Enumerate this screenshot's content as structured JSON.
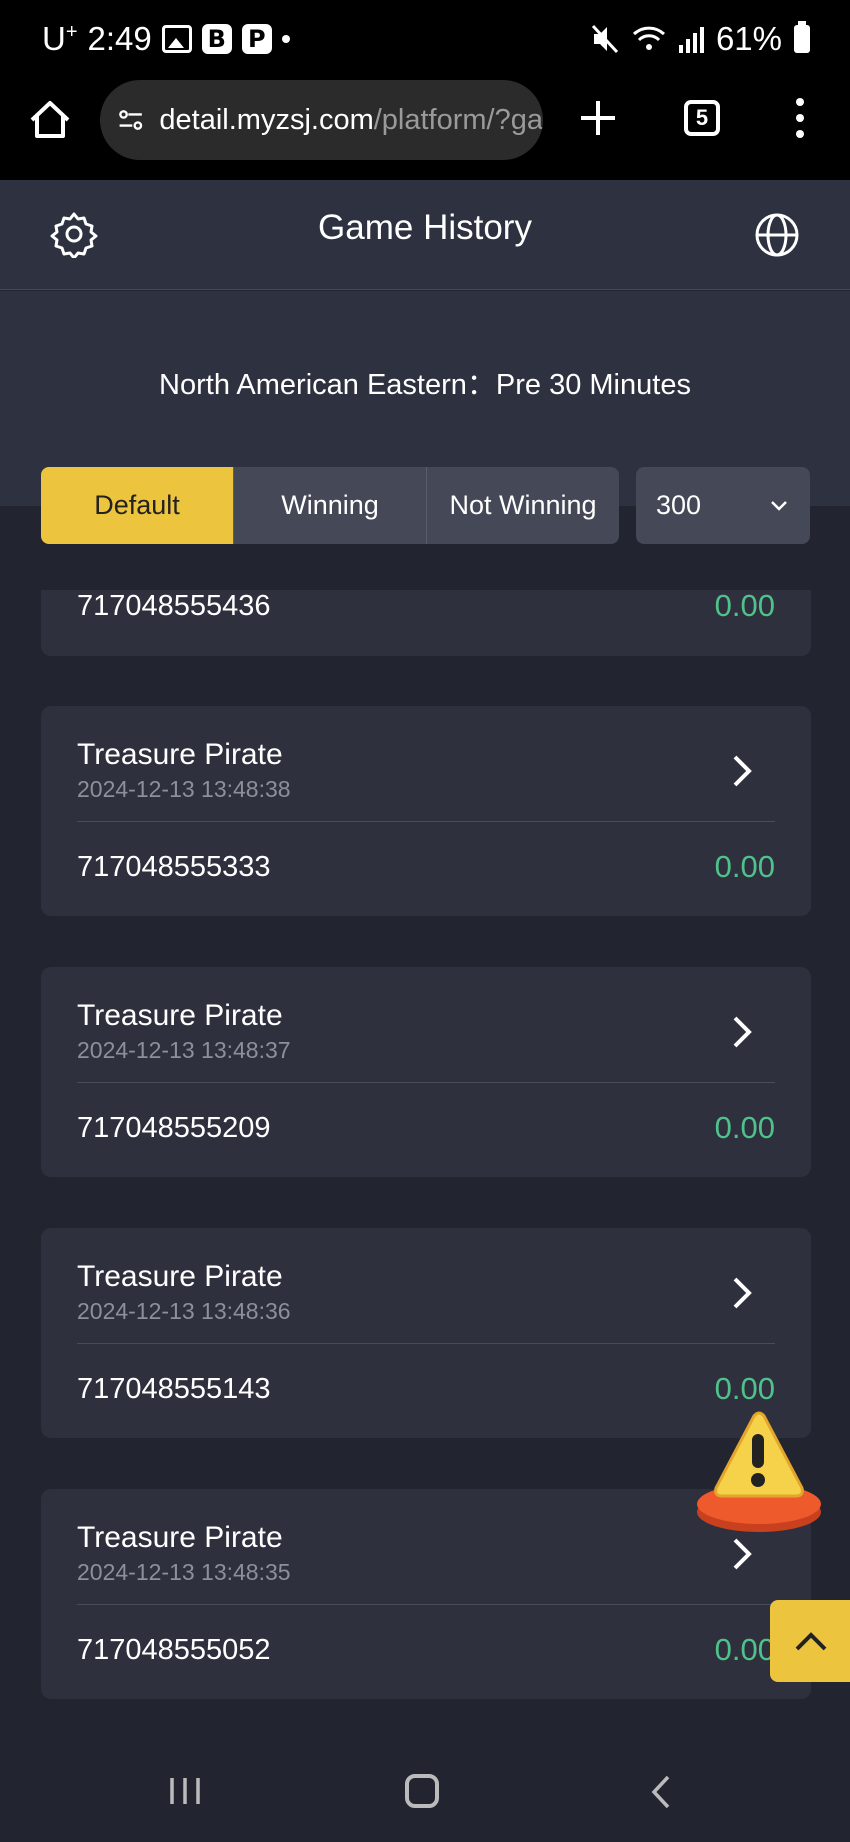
{
  "status_bar": {
    "carrier": "U",
    "carrier_sup": "+",
    "time": "2:49",
    "badge_b": "B",
    "badge_p": "P",
    "battery": "61%"
  },
  "browser": {
    "url_host": "detail.myzsj.com",
    "url_path": "/platform/?ga",
    "tab_count": "5"
  },
  "header": {
    "title": "Game History"
  },
  "filter": {
    "timezone_label": "North American Eastern：Pre 30 Minutes",
    "tabs": [
      {
        "label": "Default",
        "active": true
      },
      {
        "label": "Winning",
        "active": false
      },
      {
        "label": "Not Winning",
        "active": false
      }
    ],
    "count_value": "300"
  },
  "partial_record": {
    "order_id": "717048555436",
    "amount": "0.00"
  },
  "records": [
    {
      "game": "Treasure Pirate",
      "time": "2024-12-13 13:48:38",
      "order_id": "717048555333",
      "amount": "0.00"
    },
    {
      "game": "Treasure Pirate",
      "time": "2024-12-13 13:48:37",
      "order_id": "717048555209",
      "amount": "0.00"
    },
    {
      "game": "Treasure Pirate",
      "time": "2024-12-13 13:48:36",
      "order_id": "717048555143",
      "amount": "0.00"
    },
    {
      "game": "Treasure Pirate",
      "time": "2024-12-13 13:48:35",
      "order_id": "717048555052",
      "amount": "0.00"
    }
  ],
  "colors": {
    "accent": "#edc43e",
    "win_green": "#4fc28c",
    "card_bg": "#2e303d",
    "page_bg": "#22242f"
  },
  "icons": [
    "gear-icon",
    "globe-icon",
    "chevron-right-icon",
    "chevron-down-icon",
    "warning-icon",
    "chevron-up-icon"
  ]
}
